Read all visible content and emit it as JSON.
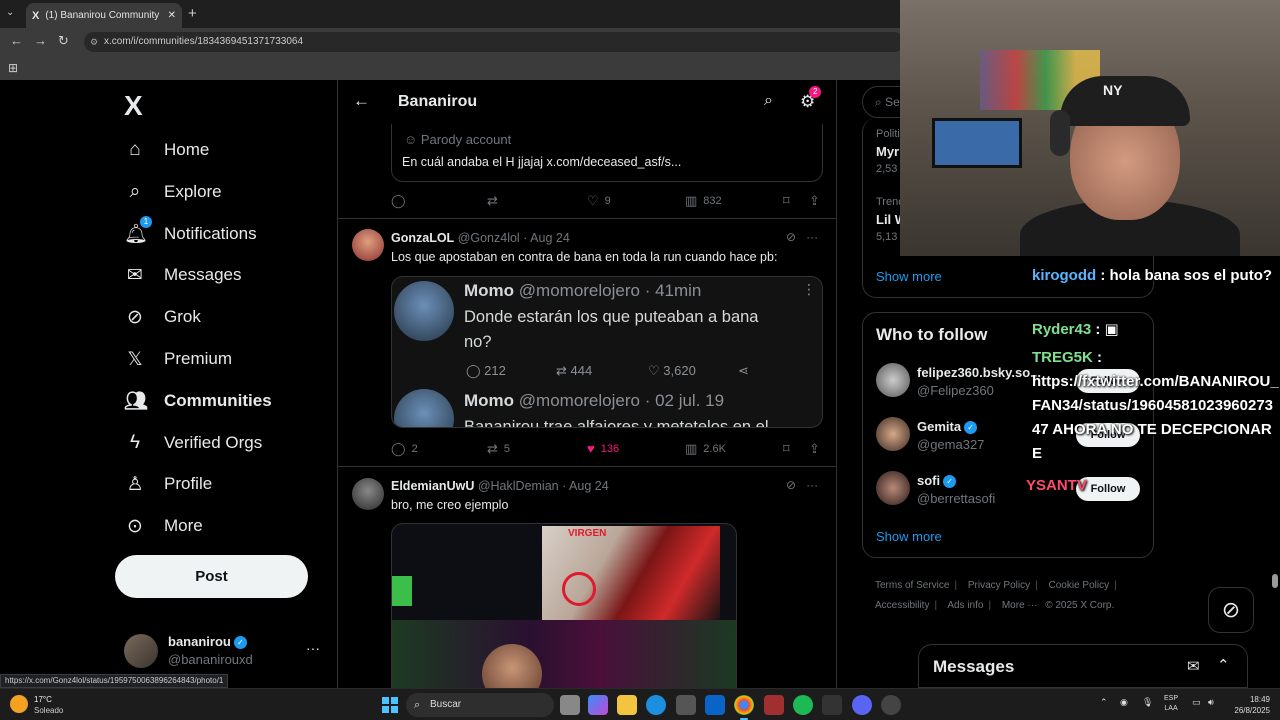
{
  "browser": {
    "tab_title": "(1) Bananirou Community / X",
    "tab_favicon": "X",
    "url": "x.com/i/communities/1834369451371733064",
    "status_url": "https://x.com/Gonz4lol/status/1959750063896264843/photo/1"
  },
  "nav": {
    "logo": "X",
    "items": [
      {
        "label": "Home",
        "icon": "home-icon",
        "glyph": "⌂"
      },
      {
        "label": "Explore",
        "icon": "search-icon",
        "glyph": "⌕"
      },
      {
        "label": "Notifications",
        "icon": "bell-icon",
        "glyph": "🔔︎",
        "badge": "1"
      },
      {
        "label": "Messages",
        "icon": "envelope-icon",
        "glyph": "✉"
      },
      {
        "label": "Grok",
        "icon": "grok-icon",
        "glyph": "⊘"
      },
      {
        "label": "Premium",
        "icon": "x-premium-icon",
        "glyph": "𝕏"
      },
      {
        "label": "Communities",
        "icon": "people-icon",
        "glyph": "👥︎"
      },
      {
        "label": "Verified Orgs",
        "icon": "lightning-icon",
        "glyph": "ϟ"
      },
      {
        "label": "Profile",
        "icon": "person-icon",
        "glyph": "♙"
      },
      {
        "label": "More",
        "icon": "more-circle-icon",
        "glyph": "⊙"
      }
    ],
    "post_label": "Post",
    "account": {
      "name": "bananirou",
      "handle": "@bananirouxd",
      "more": "···"
    }
  },
  "header": {
    "title": "Bananirou",
    "notif_badge": "2"
  },
  "tweets": {
    "t0": {
      "parody_label": "Parody account",
      "quote_text": "En cuál andaba el H jjajaj x.com/deceased_asf/s...",
      "replies": "",
      "retweets": "",
      "likes": "9",
      "views": "832"
    },
    "t1": {
      "name": "GonzaLOL",
      "handle": "@Gonz4lol",
      "date": "· Aug 24",
      "text": "Los que apostaban en contra de bana en toda la run cuando hace pb:",
      "media": {
        "r1_name": "Momo",
        "r1_handle": "@momorelojero · 41min",
        "r1_text": "Donde estarán los que puteaban a bana  no?",
        "r1_replies": "212",
        "r1_retweets": "444",
        "r1_likes": "3,620",
        "r2_name": "Momo",
        "r2_handle": "@momorelojero · 02 jul. 19",
        "r2_text": "Bananirou trae alfajores y metetelos en el"
      },
      "replies": "2",
      "retweets": "5",
      "likes": "136",
      "views": "2.6K"
    },
    "t2": {
      "name": "EldemianUwU",
      "handle": "@HaklDemian",
      "date": "· Aug 24",
      "text": "bro, me creo ejemplo",
      "media_label": "VIRGEN"
    }
  },
  "sidebar": {
    "search_placeholder": "Se",
    "trends": [
      {
        "category": "Politi",
        "name": "Myr",
        "count": "2,53"
      },
      {
        "category": "Trenc",
        "name": "Lil W",
        "count": "5,13"
      }
    ],
    "show_more": "Show more",
    "who_to_follow_title": "Who to follow",
    "follow": [
      {
        "name": "felipez360.bsky.so...",
        "handle": "@Felipez360",
        "btn": "Follow"
      },
      {
        "name": "Gemita",
        "handle": "@gema327",
        "btn": "Follow"
      },
      {
        "name": "sofi",
        "handle": "@berrettasofi",
        "btn": "Follow"
      }
    ],
    "show_more_2": "Show more",
    "footer": [
      "Terms of Service",
      "Privacy Policy",
      "Cookie Policy",
      "Accessibility",
      "Ads info",
      "More ···",
      "© 2025 X Corp."
    ]
  },
  "messages_drawer": {
    "title": "Messages"
  },
  "chat": [
    {
      "user": "kirogodd",
      "msg": ": hola bana sos el puto?"
    },
    {
      "user": "Ryder43",
      "msg": ":"
    },
    {
      "user": "TREG5K",
      "msg": ":"
    },
    {
      "user": "",
      "msg": "https://fxtwitter.com/BANANIROU_FAN34/status/1960458102396027347 AHORA NO TE DECEPCIONARE"
    },
    {
      "user": "YSANTV",
      "msg": ""
    }
  ],
  "taskbar": {
    "weather_temp": "17°C",
    "weather_desc": "Soleado",
    "search_label": "Buscar",
    "lang_1": "ESP",
    "lang_2": "LAA",
    "time": "18:49",
    "date": "26/8/2025"
  },
  "colors": {
    "accent": "#1d9bf0",
    "like": "#f91880",
    "bg": "#000000"
  }
}
